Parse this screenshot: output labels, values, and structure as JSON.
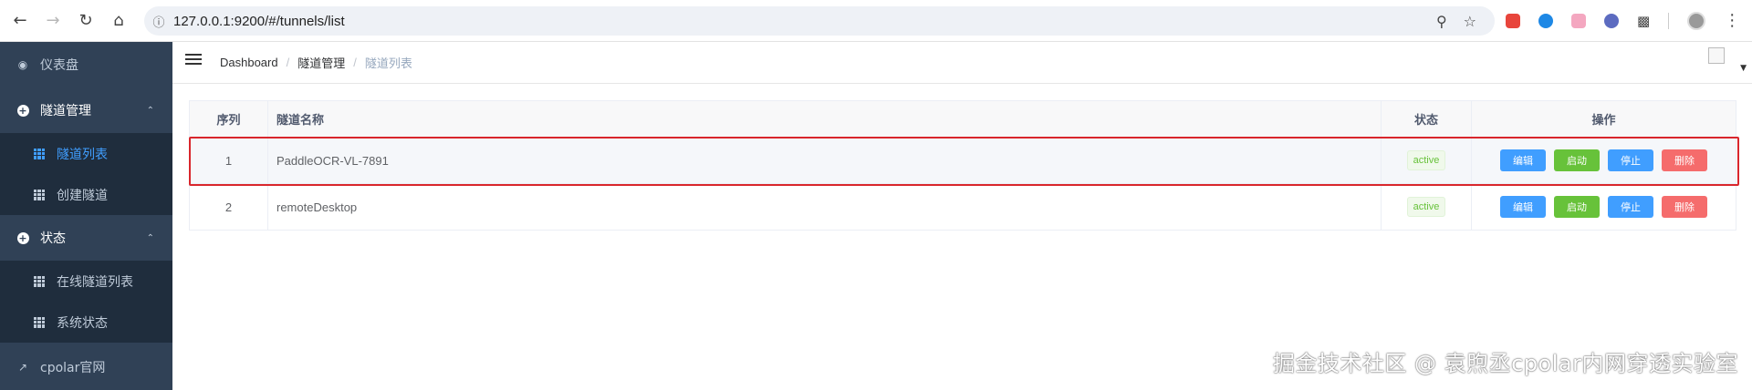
{
  "browser": {
    "url": "127.0.0.1:9200/#/tunnels/list",
    "extension_colors": [
      "#e8453c",
      "#1e88e5",
      "#f4a7c0",
      "#5c6bc0"
    ]
  },
  "sidebar": {
    "dashboard_label": "仪表盘",
    "tunnel_group_label": "隧道管理",
    "tunnel_list_label": "隧道列表",
    "create_tunnel_label": "创建隧道",
    "status_group_label": "状态",
    "online_tunnels_label": "在线隧道列表",
    "system_status_label": "系统状态",
    "official_site_label": "cpolar官网"
  },
  "breadcrumb": {
    "home": "Dashboard",
    "section": "隧道管理",
    "current": "隧道列表",
    "separator": "/"
  },
  "table": {
    "headers": {
      "index": "序列",
      "name": "隧道名称",
      "status": "状态",
      "actions": "操作"
    },
    "rows": [
      {
        "index": "1",
        "name": "PaddleOCR-VL-7891",
        "status": "active"
      },
      {
        "index": "2",
        "name": "remoteDesktop",
        "status": "active"
      }
    ],
    "buttons": {
      "edit": "编辑",
      "start": "启动",
      "stop": "停止",
      "delete": "删除"
    }
  },
  "watermark": "掘金技术社区 @ 袁煦丞cpolar内网穿透实验室",
  "colors": {
    "sidebar_bg": "#304156",
    "active_blue": "#409eff",
    "success_green": "#67c23a",
    "danger_red": "#f56c6c",
    "highlight_red": "#d9262c"
  }
}
